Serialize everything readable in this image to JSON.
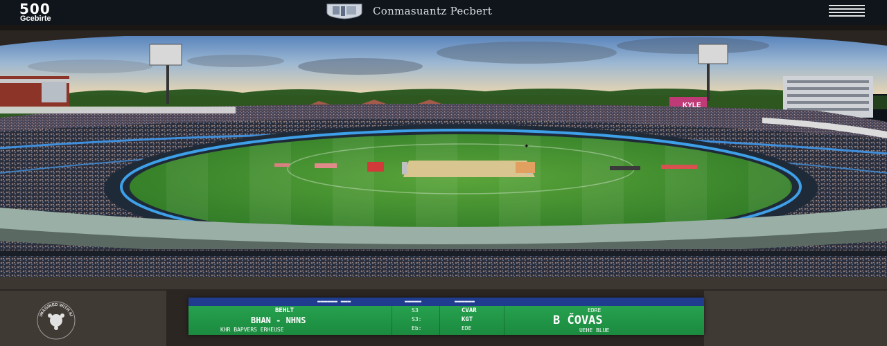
{
  "header": {
    "logo_number": "500",
    "logo_caption": "Gcebirte",
    "brand_name": "Conmasuantz Pecbert"
  },
  "scene": {
    "hoarding_text": "KYLE"
  },
  "scoreboard": {
    "header_left": "▬▬▬▬▬▬ ▬▬▬",
    "header_mid1": "▬▬▬▬▬",
    "header_mid2": "▬▬▬▬▬▬",
    "team_label": "BEHLT",
    "team_name": "BHAN - NHNS",
    "team_sub": "KHR BAPVERS ERHEUSE",
    "col2_r1": "S3",
    "col2_r2": "S3:",
    "col2_r3": "Eb:",
    "col3_r1": "CVAR",
    "col3_r2": "KGT",
    "col3_r3": "EDE",
    "col4_label": "EDRE",
    "score": "B ČOVAS",
    "col4_sub": "UEHE BLUE"
  },
  "watermark": {
    "text": "IMAGINED WITH AI"
  }
}
